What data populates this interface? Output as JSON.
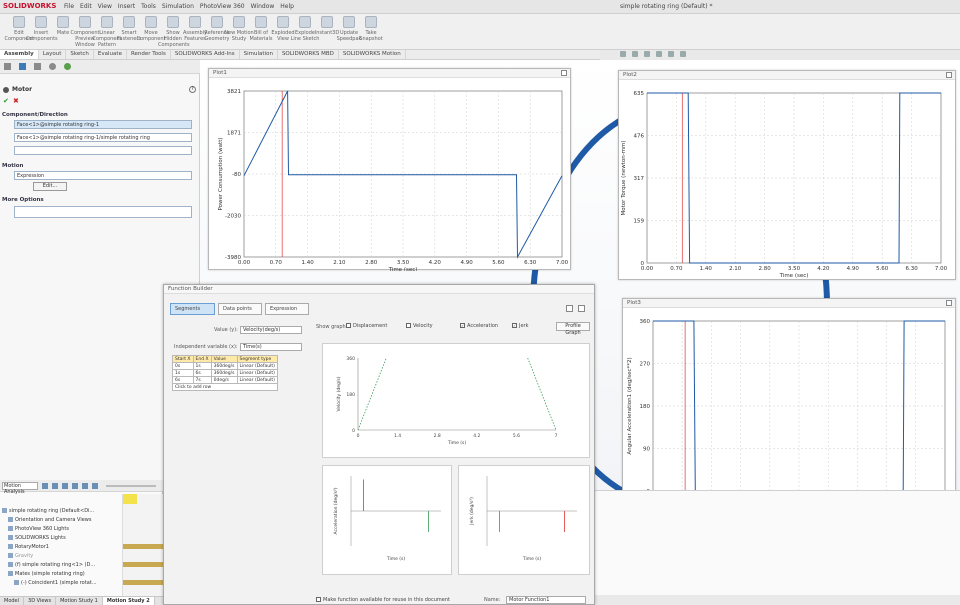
{
  "app": {
    "logo": "SOLIDWORKS",
    "doc_title": "simple rotating ring (Default) *"
  },
  "menu": [
    "File",
    "Edit",
    "View",
    "Insert",
    "Tools",
    "Simulation",
    "PhotoView 360",
    "Window",
    "Help"
  ],
  "toolbar": [
    "Edit Component",
    "Insert Components",
    "Mate",
    "Component Preview Window",
    "Linear Component Pattern",
    "Smart Fasteners",
    "Move Component",
    "Show Hidden Components",
    "Assembly Features",
    "Reference Geometry",
    "New Motion Study",
    "Bill of Materials",
    "Exploded View",
    "Explode Line Sketch",
    "Instant3D",
    "Update Speedpak",
    "Take Snapshot"
  ],
  "cmd_tabs": [
    "Assembly",
    "Layout",
    "Sketch",
    "Evaluate",
    "Render Tools",
    "SOLIDWORKS Add-Ins",
    "Simulation",
    "SOLIDWORKS MBD",
    "SOLIDWORKS Motion"
  ],
  "left_panel": {
    "title": "Motor",
    "component_direction": "Component/Direction",
    "field1": "Face<1>@simple rotating ring-1",
    "field2": "Face<1>@simple rotating ring-1/simple rotating ring",
    "motion": "Motion",
    "motion_value": "Expression",
    "edit_btn": "Edit...",
    "more_options": "More Options"
  },
  "plot1": {
    "title": "Plot1",
    "ylabel": "Power Consumption (watt)",
    "xlabel": "Time (sec)",
    "yticks": [
      "3821",
      "1871",
      "-80",
      "-2030",
      "-3980"
    ],
    "xticks": [
      "0.00",
      "0.70",
      "1.40",
      "2.10",
      "2.80",
      "3.50",
      "4.20",
      "4.90",
      "5.60",
      "6.30",
      "7.00"
    ]
  },
  "plot2": {
    "title": "Plot2",
    "ylabel": "Motor Torque (newton-mm)",
    "xlabel": "Time (sec)",
    "yticks": [
      "635",
      "476",
      "317",
      "159",
      "0"
    ],
    "xticks": [
      "0.00",
      "0.70",
      "1.40",
      "2.10",
      "2.80",
      "3.50",
      "4.20",
      "4.90",
      "5.60",
      "6.30",
      "7.00"
    ]
  },
  "plot3": {
    "title": "Plot3",
    "ylabel": "Angular Acceleration1 (deg/sec**2)",
    "xlabel": "Time (sec)",
    "yticks": [
      "360",
      "270",
      "180",
      "90",
      "0"
    ],
    "xticks": [
      "0.00",
      "0.70",
      "1.40",
      "2.10",
      "2.80",
      "3.50",
      "4.20",
      "4.90",
      "5.60",
      "6.30",
      "7.00"
    ]
  },
  "function_builder": {
    "title": "Function Builder",
    "modes": [
      "Segments",
      "Data points",
      "Expression"
    ],
    "value_label": "Value (y):",
    "value_sel": "Velocity(deg/s)",
    "indep_label": "Independent variable (x):",
    "indep_sel": "Time(s)",
    "show_graphs": "Show graphs:",
    "checks": [
      "Displacement",
      "Velocity",
      "Acceleration",
      "Jerk"
    ],
    "checked": [
      false,
      false,
      true,
      true
    ],
    "profile_btn": "Profile Graph",
    "table_head": [
      "Start X",
      "End X",
      "Value",
      "Segment type"
    ],
    "table_rows": [
      [
        "0s",
        "1s",
        "360deg/s",
        "Linear (Default)"
      ],
      [
        "1s",
        "6s",
        "360deg/s",
        "Linear (Default)"
      ],
      [
        "6s",
        "7s",
        "0deg/s",
        "Linear (Default)"
      ]
    ],
    "table_more": "Click to add row",
    "top_ylabel": "Velocity (deg/s)",
    "top_xlabel": "Time (s)",
    "top_xticks": [
      "0",
      "1.4",
      "2.8",
      "4.2",
      "5.6",
      "7"
    ],
    "top_yticks": [
      "360",
      "180",
      "0"
    ],
    "bl_ylabel": "Acceleration (deg/s²)",
    "bl_xlabel": "Time (s)",
    "br_ylabel": "Jerk (deg/s³)",
    "br_xlabel": "Time (s)",
    "footer_check": "Make function available for reuse in this document",
    "name_label": "Name:",
    "name_value": "Motor Function1"
  },
  "motion_manager": {
    "study": "Motion Analysis",
    "rows": [
      "simple rotating ring (Default<Di...",
      "Orientation and Camera Views",
      "PhotoView 360 Lights",
      "SOLIDWORKS Lights",
      "RotaryMotor1",
      "Gravity",
      "(f) simple rotating ring<1> (D...",
      "Mates (simple rotating ring)",
      "(-) Coincident1 (simple rotat..."
    ]
  },
  "bottom_tabs": [
    "Model",
    "3D Views",
    "Motion Study 1",
    "Motion Study 2"
  ]
}
